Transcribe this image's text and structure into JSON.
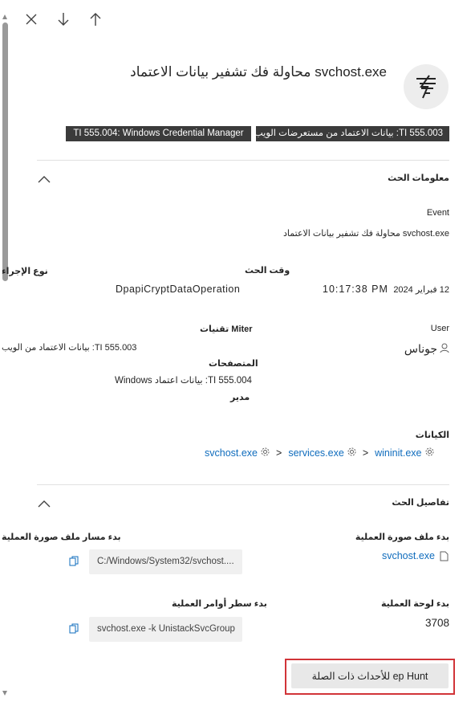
{
  "toolbar": {
    "close_icon": "close-icon",
    "down_icon": "arrow-down-icon",
    "up_icon": "arrow-up-icon"
  },
  "header": {
    "title": "svchost.exe محاولة فك تشفير بيانات الاعتماد",
    "icon": "threat-lines-icon"
  },
  "tags": [
    "TI 555.004: Windows Credential Manager",
    "TI 555.003: بيانات الاعتماد من مستعرضات الويب"
  ],
  "hunt_info": {
    "section_title": "معلومات الحث",
    "event_label": "Event",
    "event_value": "svchost.exe محاولة فك تشفير بيانات الاعتماد",
    "event_time_label": "وقت الحث",
    "action_type_label": "نوع الإجراء",
    "date_value": "12 فبراير 2024",
    "time_value": "10:17:38 PM",
    "action_type_value": "DpapiCryptDataOperation",
    "user_label": "User",
    "user_value": "جوناس",
    "miter_label": "تقنيات Miter",
    "miter_line1": "TI 555.003: بيانات الاعتماد من الويب",
    "miter_line2": "المتصفحات",
    "miter_line3": "TI 555.004: بيانات اعتماد Windows",
    "miter_line4": "مدير",
    "entities_label": "الكيانات",
    "entities": [
      "wininit.exe",
      "services.exe",
      "svchost.exe"
    ],
    "entity_separator": ">"
  },
  "hunt_details": {
    "section_title": "تفاصيل الحث",
    "image_file_label": "بدء ملف صورة العملية",
    "image_file_value": "svchost.exe",
    "image_path_label": "بدء مسار ملف صورة العملية",
    "image_path_value": "C:/Windows/System32/svchost....",
    "pid_label": "بدء لوحة العملية",
    "pid_value": "3708",
    "cmdline_label": "بدء سطر أوامر العملية",
    "cmdline_value": "svchost.exe -k UnistackSvcGroup"
  },
  "actions": {
    "hunt_button_label": "ep Hunt للأحداث ذات الصلة"
  },
  "colors": {
    "link": "#0f6cbd",
    "tag_bg": "#3b3b3b",
    "highlight": "#d13438"
  }
}
